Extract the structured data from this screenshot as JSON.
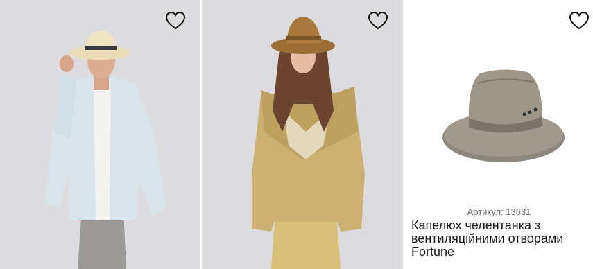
{
  "cards": [
    {
      "photo_alt": "man in straw hat",
      "favorite_icon": "heart-outline-icon"
    },
    {
      "photo_alt": "woman in suede fringe jacket",
      "favorite_icon": "heart-outline-icon"
    },
    {
      "photo_alt": "grey trilby hat",
      "favorite_icon": "heart-outline-icon",
      "sku": "Артикул: 13631",
      "title": "Капелюх челентанка з вентиляційними отворами Fortune"
    }
  ],
  "colors": {
    "photo_bg": "#dcdcde",
    "text": "#1a1a1a",
    "sku_text": "#6b6b6b"
  }
}
